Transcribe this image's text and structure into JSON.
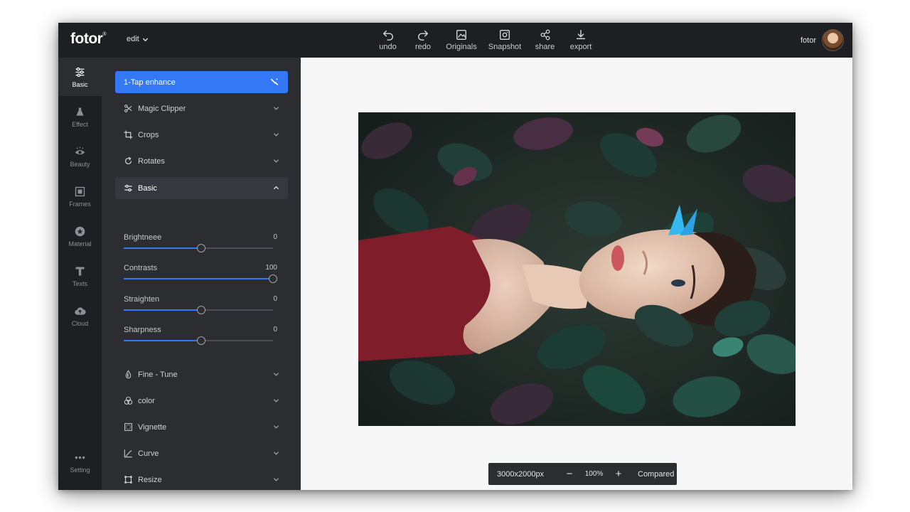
{
  "topbar": {
    "logo": "fotor",
    "logo_mark": "®",
    "edit_label": "edit",
    "tools": [
      {
        "label": "undo",
        "icon": "undo-icon"
      },
      {
        "label": "redo",
        "icon": "redo-icon"
      },
      {
        "label": "Originals",
        "icon": "image-icon"
      },
      {
        "label": "Snapshot",
        "icon": "snapshot-icon"
      },
      {
        "label": "share",
        "icon": "share-icon"
      },
      {
        "label": "export",
        "icon": "download-icon"
      }
    ],
    "user_name": "fotor"
  },
  "rail": {
    "items": [
      {
        "label": "Basic",
        "icon": "sliders-icon",
        "active": true
      },
      {
        "label": "Effect",
        "icon": "flask-icon"
      },
      {
        "label": "Beauty",
        "icon": "eye-icon"
      },
      {
        "label": "Frames",
        "icon": "frame-icon"
      },
      {
        "label": "Material",
        "icon": "star-badge-icon"
      },
      {
        "label": "Texts",
        "icon": "text-icon"
      },
      {
        "label": "Cloud",
        "icon": "cloud-upload-icon"
      }
    ],
    "setting_label": "Setting",
    "setting_icon": "dots-icon"
  },
  "panel": {
    "enhance_label": "1-Tap enhance",
    "top_items": [
      {
        "label": "Magic Clipper",
        "icon": "scissors-icon"
      },
      {
        "label": "Crops",
        "icon": "crop-icon"
      },
      {
        "label": "Rotates",
        "icon": "rotate-icon"
      }
    ],
    "basic_label": "Basic",
    "sliders": [
      {
        "label": "Brightneee",
        "value": "0",
        "level": 0.52
      },
      {
        "label": "Contrasts",
        "value": "100",
        "level": 1.0
      },
      {
        "label": "Straighten",
        "value": "0",
        "level": 0.52
      },
      {
        "label": "Sharpness",
        "value": "0",
        "level": 0.52
      }
    ],
    "bottom_items": [
      {
        "label": "Fine - Tune",
        "icon": "drop-icon"
      },
      {
        "label": "color",
        "icon": "color-circles-icon"
      },
      {
        "label": "Vignette",
        "icon": "vignette-icon"
      },
      {
        "label": "Curve",
        "icon": "curve-icon"
      },
      {
        "label": "Resize",
        "icon": "resize-icon"
      }
    ]
  },
  "status": {
    "size": "3000x2000px",
    "zoom": "100%",
    "minus": "−",
    "plus": "+",
    "compare": "Compared"
  },
  "colors": {
    "accent": "#3478f6",
    "topbar": "#1e1f22",
    "panel": "#2b2d31",
    "canvas": "#f7f7f8"
  }
}
